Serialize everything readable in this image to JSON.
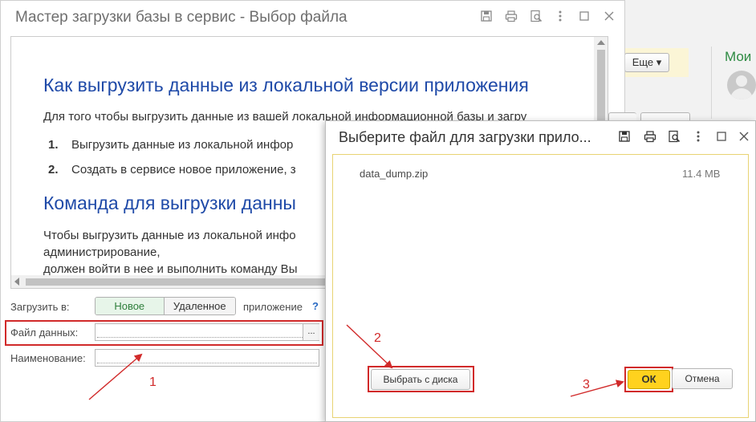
{
  "background_app": {
    "more_button": "Еще ▾",
    "side_title": "Мои"
  },
  "main_window": {
    "title": "Мастер загрузки базы в сервис - Выбор файла",
    "content": {
      "heading1": "Как выгрузить данные из локальной версии приложения",
      "para1": "Для того чтобы выгрузить данные из вашей локальной информационной базы и загру",
      "steps": [
        {
          "num": "1.",
          "text": "Выгрузить данные из локальной инфор"
        },
        {
          "num": "2.",
          "text": "Создать в сервисе новое приложение, з"
        }
      ],
      "heading2": "Команда для выгрузки данны",
      "para2_line1": "Чтобы выгрузить данные из локальной инфо",
      "para2_line2": "администрирование,",
      "para2_line3": "должен войти в нее и выполнить команду Вы"
    },
    "form": {
      "load_into_label": "Загрузить в:",
      "toggle_new": "Новое",
      "toggle_remote": "Удаленное",
      "app_label": "приложение",
      "help": "?",
      "data_file_label": "Файл данных:",
      "data_file_value": "",
      "choose_button": "...",
      "name_label": "Наименование:",
      "name_value": ""
    }
  },
  "file_dialog": {
    "title": "Выберите файл для загрузки прило...",
    "files": [
      {
        "name": "data_dump.zip",
        "size": "11.4 MB"
      }
    ],
    "choose_from_disk_button": "Выбрать с диска",
    "ok_button": "ОК",
    "cancel_button": "Отмена"
  },
  "annotations": {
    "step1": "1",
    "step2": "2",
    "step3": "3",
    "color": "#d12a2a"
  }
}
